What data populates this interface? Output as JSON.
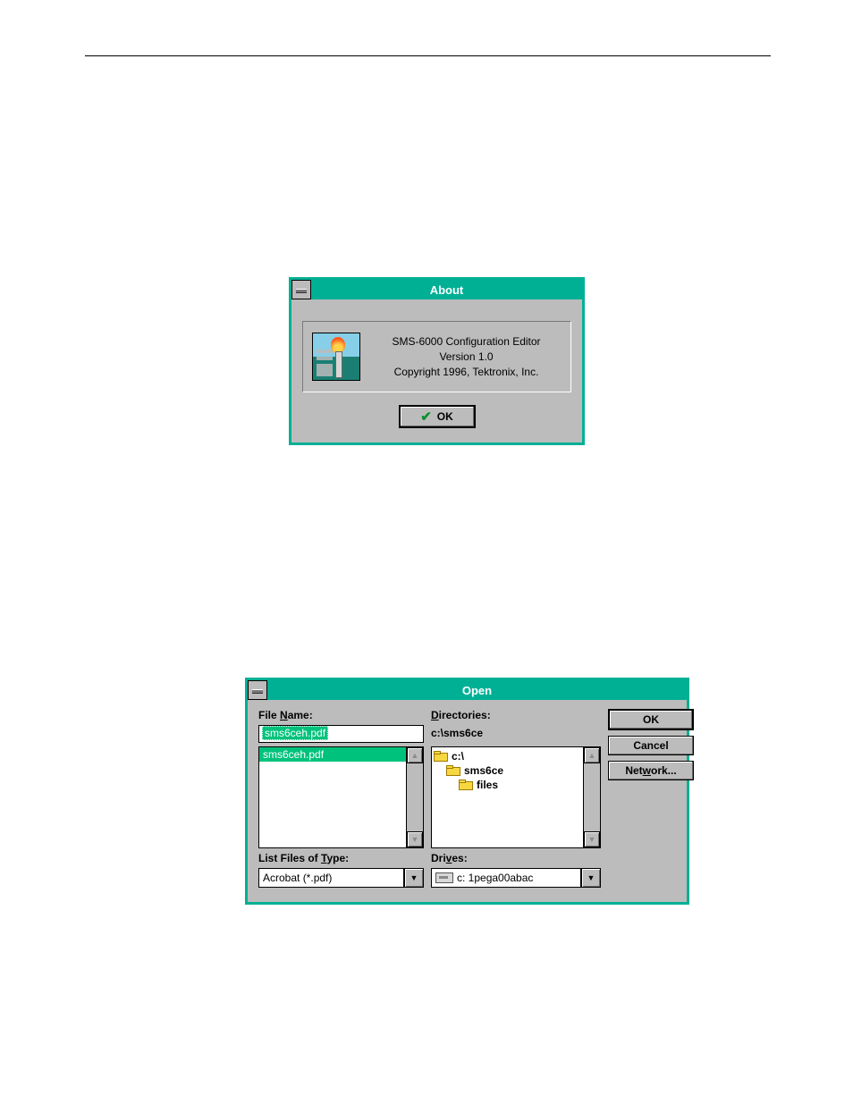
{
  "about_dialog": {
    "title": "About",
    "product": "SMS-6000 Configuration Editor",
    "version": "Version 1.0",
    "copyright": "Copyright 1996, Tektronix, Inc.",
    "ok_label": "OK"
  },
  "open_dialog": {
    "title": "Open",
    "labels": {
      "file_name": "File Name:",
      "file_name_ul": "N",
      "directories": "Directories:",
      "directories_ul": "D",
      "list_type": "List Files of Type:",
      "list_type_ul": "T",
      "drives": "Drives:",
      "drives_ul": "v"
    },
    "file_name_value": "sms6ceh.pdf",
    "current_path": "c:\\sms6ce",
    "file_list": [
      "sms6ceh.pdf"
    ],
    "dir_tree": [
      {
        "name": "c:\\",
        "level": 0,
        "open": true
      },
      {
        "name": "sms6ce",
        "level": 1,
        "open": true
      },
      {
        "name": "files",
        "level": 2,
        "open": false
      }
    ],
    "type_filter": "Acrobat (*.pdf)",
    "drive": "c: 1pega00abac",
    "buttons": {
      "ok": "OK",
      "cancel": "Cancel",
      "network": "Network...",
      "network_ul": "w"
    }
  }
}
